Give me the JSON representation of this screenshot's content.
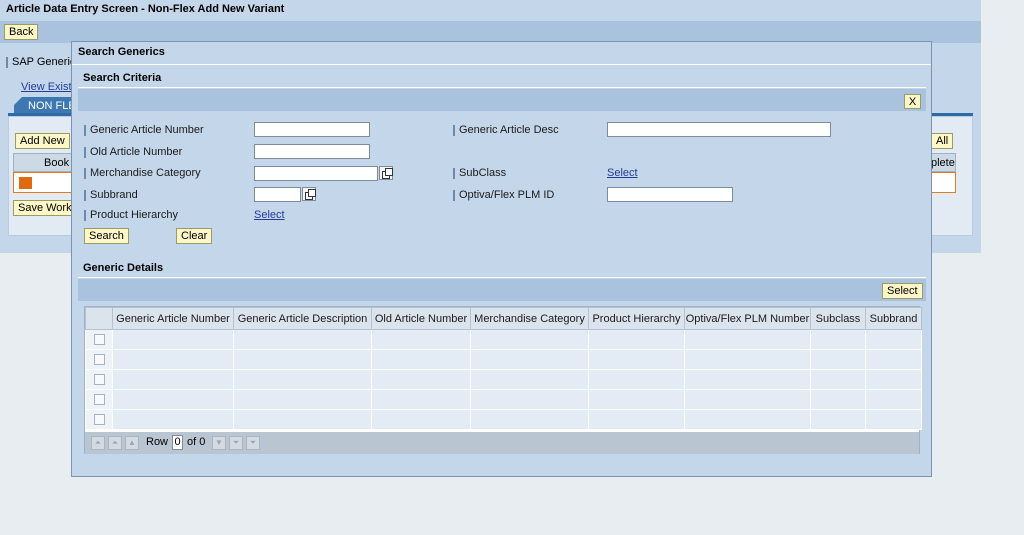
{
  "app": {
    "title": "Article Data Entry Screen - Non-Flex Add New Variant",
    "back_label": "Back",
    "sap_group_label": "SAP Generic",
    "view_existing_link": "View Exist",
    "tab_label": "NON FLE",
    "add_new_label": "Add New",
    "all_label": "All",
    "book_header": "Book",
    "complete_header": "plete",
    "save_work_label": "Save Work"
  },
  "dialog": {
    "title": "Search Generics",
    "criteria_title": "Search Criteria",
    "close_label": "X",
    "fields": {
      "generic_article_number": {
        "label": "Generic Article Number",
        "value": ""
      },
      "generic_article_desc": {
        "label": "Generic Article Desc",
        "value": ""
      },
      "old_article_number": {
        "label": "Old Article Number",
        "value": ""
      },
      "merchandise_category": {
        "label": "Merchandise Category",
        "value": ""
      },
      "subclass": {
        "label": "SubClass",
        "link": "Select"
      },
      "subbrand": {
        "label": "Subbrand",
        "value": ""
      },
      "optiva_plm_id": {
        "label": "Optiva/Flex PLM ID",
        "value": ""
      },
      "product_hierarchy": {
        "label": "Product Hierarchy",
        "link": "Select"
      }
    },
    "search_label": "Search",
    "clear_label": "Clear",
    "details_title": "Generic Details",
    "select_label": "Select",
    "columns": [
      "Generic Article Number",
      "Generic Article Description",
      "Old Article Number",
      "Merchandise Category",
      "Product Hierarchy",
      "Optiva/Flex PLM Number",
      "Subclass",
      "Subbrand"
    ],
    "row_count": 5,
    "pager": {
      "row_label": "Row",
      "row_value": "0",
      "of_label": "of 0"
    }
  },
  "colors": {
    "panel": "#c4d7ea",
    "toolbar": "#a9c3de",
    "button": "#fdf7c7",
    "link": "#233b9b",
    "tab": "#2f6aa6",
    "accent_orange": "#df6a10"
  }
}
